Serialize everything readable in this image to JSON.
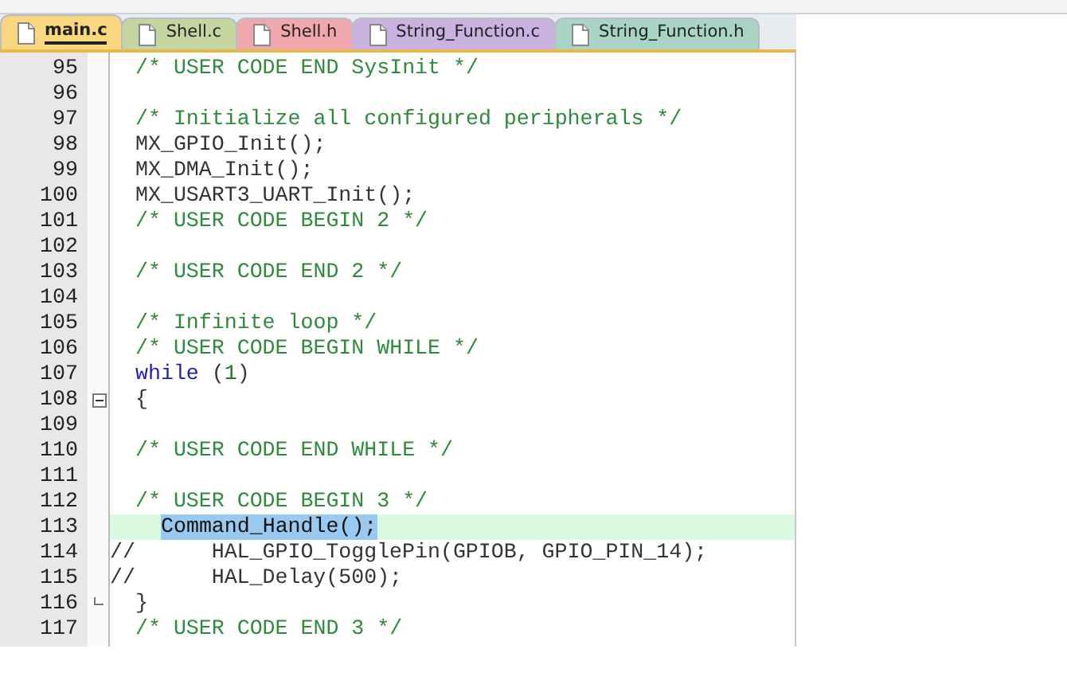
{
  "tabs": [
    {
      "label": "main.c",
      "selected": true,
      "color": "#f9d77e"
    },
    {
      "label": "Shell.c",
      "selected": false,
      "color": "#c4d6a0"
    },
    {
      "label": "Shell.h",
      "selected": false,
      "color": "#f0a8ae"
    },
    {
      "label": "String_Function.c",
      "selected": false,
      "color": "#c9b1e0"
    },
    {
      "label": "String_Function.h",
      "selected": false,
      "color": "#a9d4c4"
    }
  ],
  "lines": [
    {
      "number": "95",
      "kind": "body",
      "parts": [
        {
          "kind": "comment",
          "text": "/* USER CODE END SysInit */"
        }
      ]
    },
    {
      "number": "96",
      "kind": "blank"
    },
    {
      "number": "97",
      "kind": "body",
      "parts": [
        {
          "kind": "comment",
          "text": "/* Initialize all configured peripherals */"
        }
      ]
    },
    {
      "number": "98",
      "kind": "body",
      "parts": [
        {
          "kind": "code",
          "text": "MX_GPIO_Init();"
        }
      ]
    },
    {
      "number": "99",
      "kind": "body",
      "parts": [
        {
          "kind": "code",
          "text": "MX_DMA_Init();"
        }
      ]
    },
    {
      "number": "100",
      "kind": "body",
      "parts": [
        {
          "kind": "code",
          "text": "MX_USART3_UART_Init();"
        }
      ]
    },
    {
      "number": "101",
      "kind": "body",
      "parts": [
        {
          "kind": "comment",
          "text": "/* USER CODE BEGIN 2 */"
        }
      ]
    },
    {
      "number": "102",
      "kind": "blank"
    },
    {
      "number": "103",
      "kind": "body",
      "parts": [
        {
          "kind": "comment",
          "text": "/* USER CODE END 2 */"
        }
      ]
    },
    {
      "number": "104",
      "kind": "blank"
    },
    {
      "number": "105",
      "kind": "body",
      "parts": [
        {
          "kind": "comment",
          "text": "/* Infinite loop */"
        }
      ]
    },
    {
      "number": "106",
      "kind": "body",
      "parts": [
        {
          "kind": "comment",
          "text": "/* USER CODE BEGIN WHILE */"
        }
      ]
    },
    {
      "number": "107",
      "kind": "body",
      "parts": [
        {
          "kind": "keyword",
          "text": "while"
        },
        {
          "kind": "code",
          "text": " ("
        },
        {
          "kind": "number",
          "text": "1"
        },
        {
          "kind": "code",
          "text": ")"
        }
      ]
    },
    {
      "number": "108",
      "kind": "body",
      "block_start": true,
      "parts": [
        {
          "kind": "code",
          "text": "{"
        }
      ]
    },
    {
      "number": "109",
      "kind": "blank"
    },
    {
      "number": "110",
      "kind": "body",
      "parts": [
        {
          "kind": "comment",
          "text": "/* USER CODE END WHILE */"
        }
      ]
    },
    {
      "number": "111",
      "kind": "blank"
    },
    {
      "number": "112",
      "kind": "body",
      "parts": [
        {
          "kind": "comment",
          "text": "/* USER CODE BEGIN 3 */"
        }
      ]
    },
    {
      "number": "113",
      "kind": "inner",
      "current": true,
      "parts": [
        {
          "kind": "selection",
          "text": "Command_Handle();"
        }
      ]
    },
    {
      "number": "114",
      "kind": "flush",
      "parts": [
        {
          "kind": "code",
          "text": "//      HAL_GPIO_TogglePin(GPIOB, GPIO_PIN_14);"
        }
      ]
    },
    {
      "number": "115",
      "kind": "flush",
      "parts": [
        {
          "kind": "code",
          "text": "//      HAL_Delay(500);"
        }
      ]
    },
    {
      "number": "116",
      "kind": "body",
      "block_end": true,
      "parts": [
        {
          "kind": "code",
          "text": "}"
        }
      ]
    },
    {
      "number": "117",
      "kind": "body",
      "parts": [
        {
          "kind": "comment",
          "text": "/* USER CODE END 3 */"
        }
      ]
    }
  ]
}
